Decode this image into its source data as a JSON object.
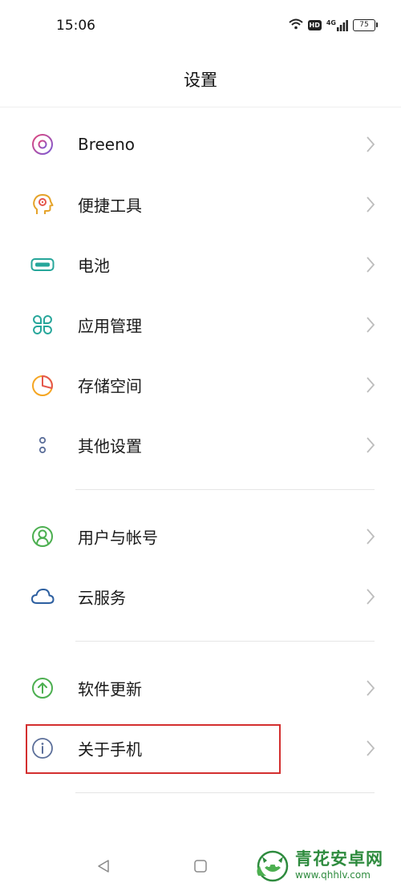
{
  "status_bar": {
    "time": "15:06",
    "hd": "HD",
    "network": "4G",
    "battery": "75"
  },
  "header": {
    "title": "设置"
  },
  "settings": [
    {
      "label": "Breeno",
      "icon": "breeno-icon",
      "color": "#b452b9"
    },
    {
      "label": "便捷工具",
      "icon": "convenience-tools-icon",
      "color": "#e5a32a"
    },
    {
      "label": "电池",
      "icon": "battery-icon",
      "color": "#26a69a"
    },
    {
      "label": "应用管理",
      "icon": "app-management-icon",
      "color": "#26a69a"
    },
    {
      "label": "存储空间",
      "icon": "storage-icon",
      "color": "#f5a623"
    },
    {
      "label": "其他设置",
      "icon": "other-settings-icon",
      "color": "#5c6f9a"
    },
    {
      "label": "用户与帐号",
      "icon": "user-account-icon",
      "color": "#4caf50"
    },
    {
      "label": "云服务",
      "icon": "cloud-icon",
      "color": "#2d5fa0"
    },
    {
      "label": "软件更新",
      "icon": "software-update-icon",
      "color": "#4caf50"
    },
    {
      "label": "关于手机",
      "icon": "info-icon",
      "color": "#5c6f9a"
    }
  ],
  "colors": {
    "chevron": "#bdbdbd",
    "highlight": "#d32f2f",
    "watermark": "#2e8b3e"
  },
  "watermark": {
    "title": "青花安卓网",
    "url": "www.qhhlv.com"
  }
}
